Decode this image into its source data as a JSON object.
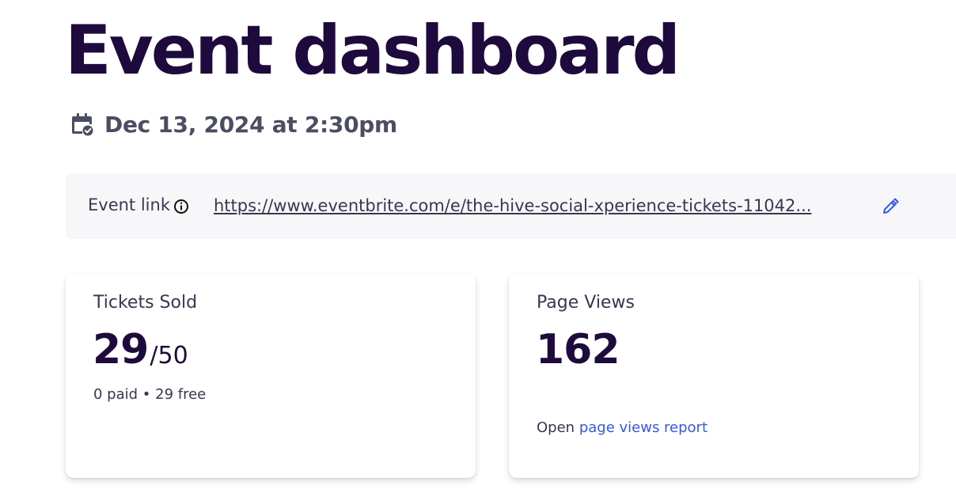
{
  "header": {
    "title": "Event dashboard",
    "date": "Dec 13, 2024 at 2:30pm",
    "date_icon": "calendar-check-icon"
  },
  "event_link": {
    "label": "Event link",
    "info_icon": "info-icon",
    "url": "https://www.eventbrite.com/e/the-hive-social-xperience-tickets-11042...",
    "edit_icon": "pencil-icon"
  },
  "cards": {
    "tickets": {
      "label": "Tickets Sold",
      "sold": "29",
      "capacity": "/50",
      "breakdown": "0 paid • 29 free"
    },
    "views": {
      "label": "Page Views",
      "value": "162",
      "footer_prefix": "Open",
      "footer_link": "page views report"
    }
  },
  "colors": {
    "title": "#1e0a3c",
    "link": "#3659e3",
    "muted": "#4b4d63",
    "link_bar_bg": "#f7f7fa"
  }
}
